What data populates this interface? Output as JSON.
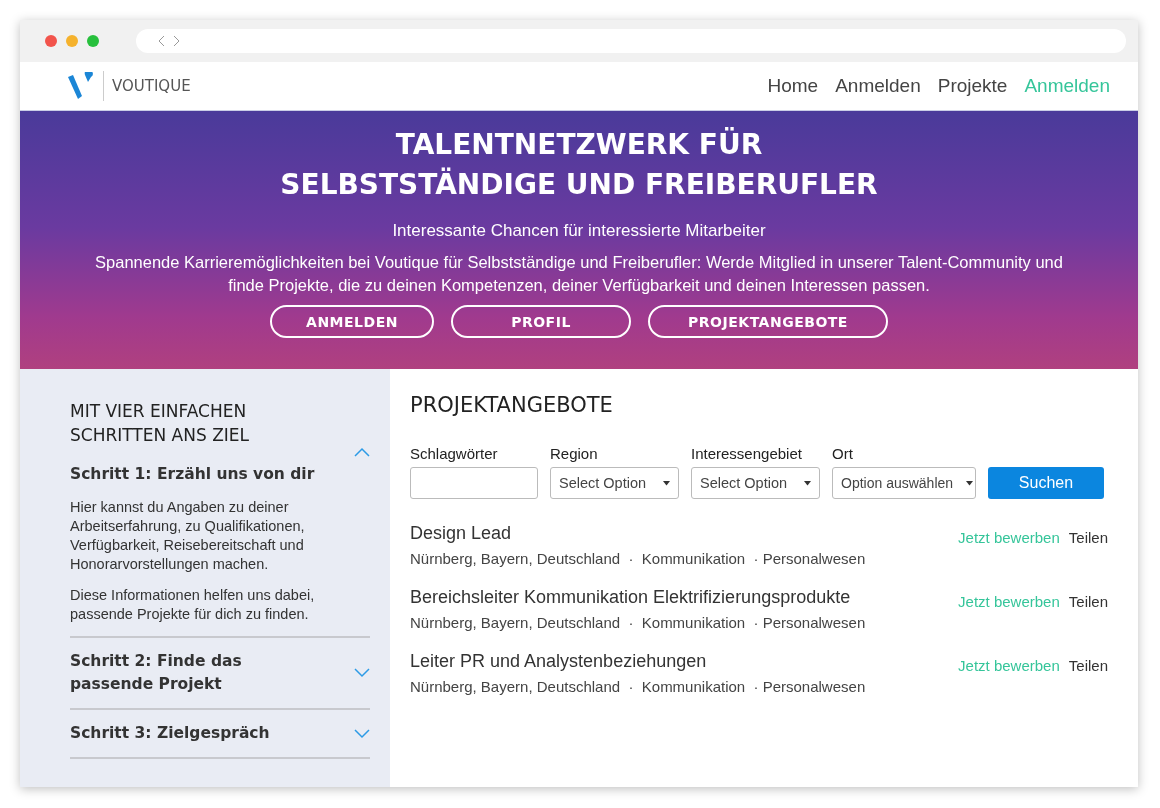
{
  "brand": {
    "name": "VOUTIQUE"
  },
  "nav": [
    {
      "label": "Home",
      "highlighted": false
    },
    {
      "label": "Anmelden",
      "highlighted": false
    },
    {
      "label": "Projekte",
      "highlighted": false
    },
    {
      "label": "Anmelden",
      "highlighted": true
    }
  ],
  "hero": {
    "title_lines": [
      "TALENTNETZWERK FÜR",
      "SELBSTSTÄNDIGE UND FREIBERUFLER"
    ],
    "subtitle": "Interessante Chancen für interessierte Mitarbeiter",
    "text": "Spannende Karrieremöglichkeiten bei Voutique für Selbstständige und Freiberufler: Werde Mitglied in unserer Talent-Community und finde Projekte, die zu deinen Kompetenzen, deiner Verfügbarkeit und deinen Interessen passen.",
    "buttons": [
      "ANMELDEN",
      "PROFIL",
      "PROJEKTANGEBOTE"
    ]
  },
  "steps": {
    "title": "MIT VIER EINFACHEN SCHRITTEN ANS ZIEL",
    "items": [
      {
        "heading": "Schritt 1: Erzähl uns von dir",
        "expanded": true,
        "paragraphs": [
          "Hier kannst du Angaben zu deiner Arbeitserfahrung, zu Qualifikationen, Verfügbarkeit, Reisebereitschaft und Honorarvorstellungen machen.",
          "Diese Informationen helfen uns dabei, passende Projekte für dich zu finden."
        ]
      },
      {
        "heading": "Schritt 2: Finde das passende Projekt",
        "expanded": false
      },
      {
        "heading": "Schritt 3: Zielgespräch",
        "expanded": false
      }
    ]
  },
  "projects": {
    "title": "PROJEKTANGEBOTE",
    "filters": [
      {
        "kind": "text",
        "label": "Schlagwörter"
      },
      {
        "kind": "select",
        "label": "Region",
        "placeholder": "Select Option"
      },
      {
        "kind": "select",
        "label": "Interessengebiet",
        "placeholder": "Select Option"
      },
      {
        "kind": "select",
        "label": "Ort",
        "placeholder": "Option auswählen"
      }
    ],
    "search_button": "Suchen",
    "rows": [
      {
        "title": "Design Lead",
        "details": "Nürnberg, Bayern, Deutschland  ·  Kommunikation  · Personalwesen",
        "apply": "Jetzt bewerben",
        "share": "Teilen"
      },
      {
        "title": "Bereichsleiter Kommunikation Elektrifizierungsprodukte",
        "details": "Nürnberg, Bayern, Deutschland  ·  Kommunikation  · Personalwesen",
        "apply": "Jetzt bewerben",
        "share": "Teilen"
      },
      {
        "title": "Leiter PR und Analystenbeziehungen",
        "details": "Nürnberg, Bayern, Deutschland  ·  Kommunikation  · Personalwesen",
        "apply": "Jetzt bewerben",
        "share": "Teilen"
      }
    ]
  }
}
